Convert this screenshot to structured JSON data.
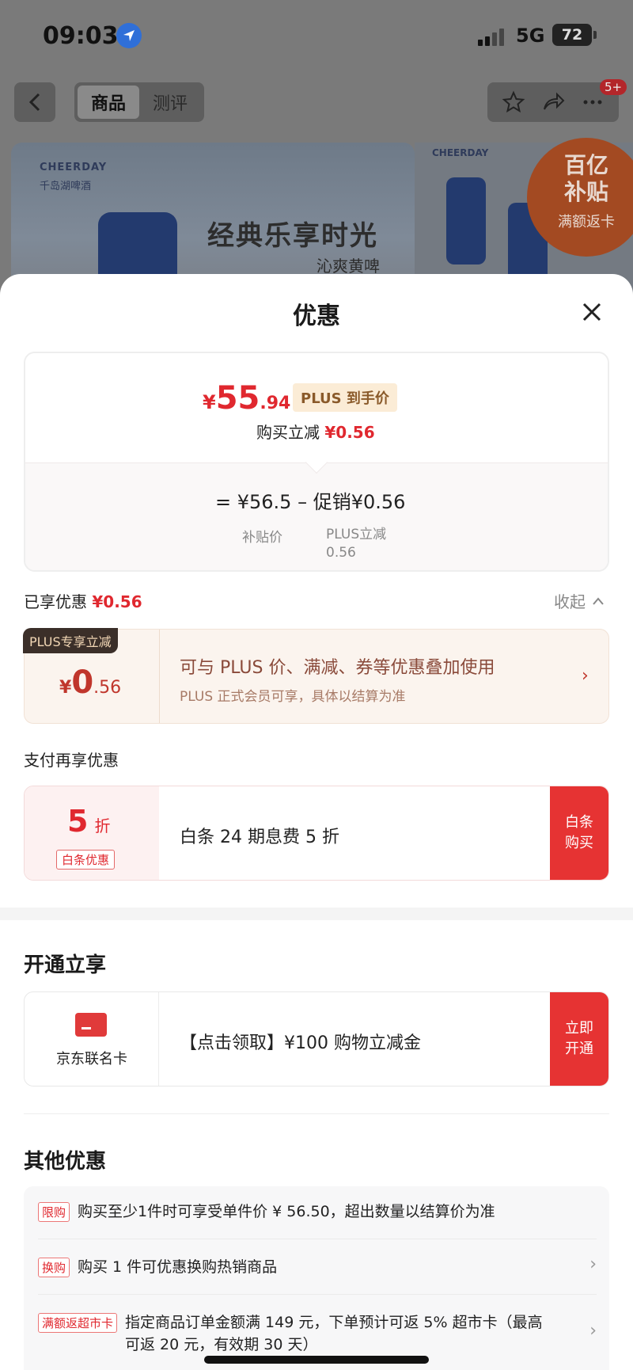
{
  "status_bar": {
    "time": "09:03",
    "network": "5G",
    "battery": "72"
  },
  "nav": {
    "tabs": [
      "商品",
      "测评"
    ],
    "active_tab": 0,
    "badge": "5+"
  },
  "banner": {
    "brand": "CHEERDAY",
    "brand_sub": "千岛湖啤酒",
    "title": "经典乐享时光",
    "subtitle": "沁爽黄啤"
  },
  "side_banner": {
    "brand": "CHEERDAY",
    "subsidy_line1": "百亿",
    "subsidy_line2": "补贴",
    "subsidy_note": "满额返卡"
  },
  "sheet": {
    "title": "优惠",
    "price": {
      "symbol": "¥",
      "integer": "55",
      "decimal": ".94",
      "tag": "PLUS 到手价",
      "instant_label": "购买立减",
      "instant_value": "¥0.56",
      "formula": "= ¥56.5 – 促销¥0.56",
      "sub_a": "补贴价",
      "sub_b_line1": "PLUS立减",
      "sub_b_line2": "0.56"
    },
    "enjoyed": {
      "label": "已享优惠",
      "value": "¥0.56",
      "collapse": "收起"
    },
    "plus_card": {
      "badge": "PLUS专享立减",
      "symbol": "¥",
      "integer": "0",
      "decimal": ".56",
      "main": "可与 PLUS 价、满减、券等优惠叠加使用",
      "sub": "PLUS 正式会员可享，具体以结算为准"
    },
    "pay_section": "支付再享优惠",
    "baitiao": {
      "discount": "5",
      "unit": "折",
      "tag": "白条优惠",
      "text": "白条 24 期息费 5 折",
      "button_line1": "白条",
      "button_line2": "购买"
    },
    "open_section": "开通立享",
    "jd_card": {
      "label": "京东联名卡",
      "text": "【点击领取】¥100 购物立减金",
      "button_line1": "立即",
      "button_line2": "开通"
    },
    "other_section": "其他优惠",
    "others": [
      {
        "tag": "限购",
        "text": "购买至少1件时可享受单件价 ¥ 56.50，超出数量以结算价为准",
        "chevron": false
      },
      {
        "tag": "换购",
        "text": "购买 1 件可优惠换购热销商品",
        "chevron": true
      },
      {
        "tag": "满额返超市卡",
        "text": "指定商品订单金额满 149 元，下单预计可返 5% 超市卡（最高可返 20 元，有效期 30 天）",
        "chevron": true
      }
    ]
  }
}
